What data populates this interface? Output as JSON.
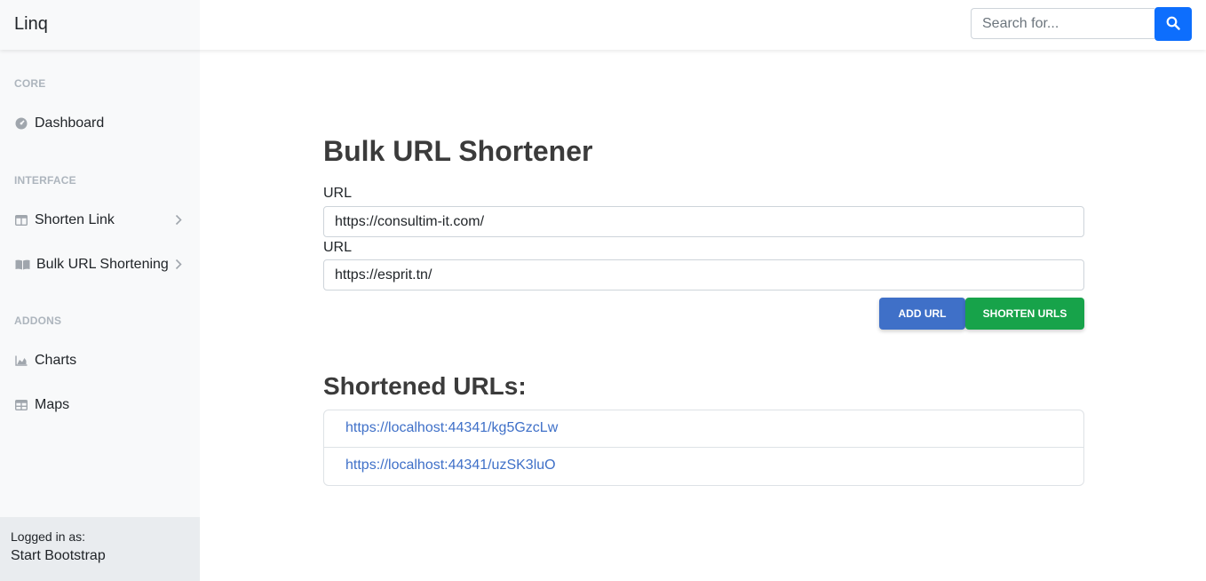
{
  "app": {
    "brand": "Linq"
  },
  "search": {
    "placeholder": "Search for..."
  },
  "sidebar": {
    "sections": {
      "core": "CORE",
      "interface": "INTERFACE",
      "addons": "ADDONS"
    },
    "items": {
      "dashboard": "Dashboard",
      "shorten_link": "Shorten Link",
      "bulk": "Bulk URL Shortening",
      "charts": "Charts",
      "maps": "Maps"
    },
    "footer": {
      "label": "Logged in as:",
      "name": "Start Bootstrap"
    }
  },
  "main": {
    "title": "Bulk URL Shortener",
    "fields": [
      {
        "label": "URL",
        "value": "https://consultim-it.com/"
      },
      {
        "label": "URL",
        "value": "https://esprit.tn/"
      }
    ],
    "buttons": {
      "add": "ADD URL",
      "shorten": "SHORTEN URLS"
    },
    "results_title": "Shortened URLs:",
    "results": [
      "https://localhost:44341/kg5GzcLw",
      "https://localhost:44341/uzSK3luO"
    ]
  },
  "colors": {
    "primary": "#0d6efd",
    "add_button": "#3f70c8",
    "shorten_button": "#17a34a",
    "link": "#3f70c8"
  }
}
